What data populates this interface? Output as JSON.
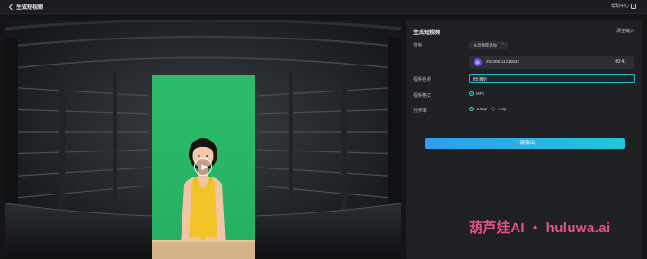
{
  "header": {
    "back_icon": "chevron-left-icon",
    "title": "生成短视频",
    "help_label": "帮助中心",
    "help_icon": "question-icon"
  },
  "preview": {
    "play_icon": "play-icon"
  },
  "panel": {
    "title": "生成短视频",
    "clear_label": "清空输入",
    "audio": {
      "label": "音频",
      "add_button": "从音频库添加",
      "more_button": "···",
      "file_icon": "audio-file-icon",
      "file_name": "202308111210632",
      "duration": "00:41"
    },
    "video_name": {
      "label": "视频名称",
      "value": "H5演示"
    },
    "format": {
      "label": "视频格式",
      "options": [
        {
          "label": "MP4",
          "selected": true
        }
      ]
    },
    "resolution": {
      "label": "分辨率",
      "options": [
        {
          "label": "1080p",
          "selected": true
        },
        {
          "label": "720p",
          "selected": false
        }
      ]
    },
    "export_button": "一键输出"
  },
  "watermark": {
    "left": "葫芦娃AI",
    "sep": "•",
    "right": "huluwa.ai"
  },
  "colors": {
    "accent": "#1ec0c7",
    "export_gradient_start": "#2c9ff0",
    "export_gradient_end": "#1fc8d8",
    "green_screen": "#2db86a",
    "watermark": "#e8508a"
  }
}
